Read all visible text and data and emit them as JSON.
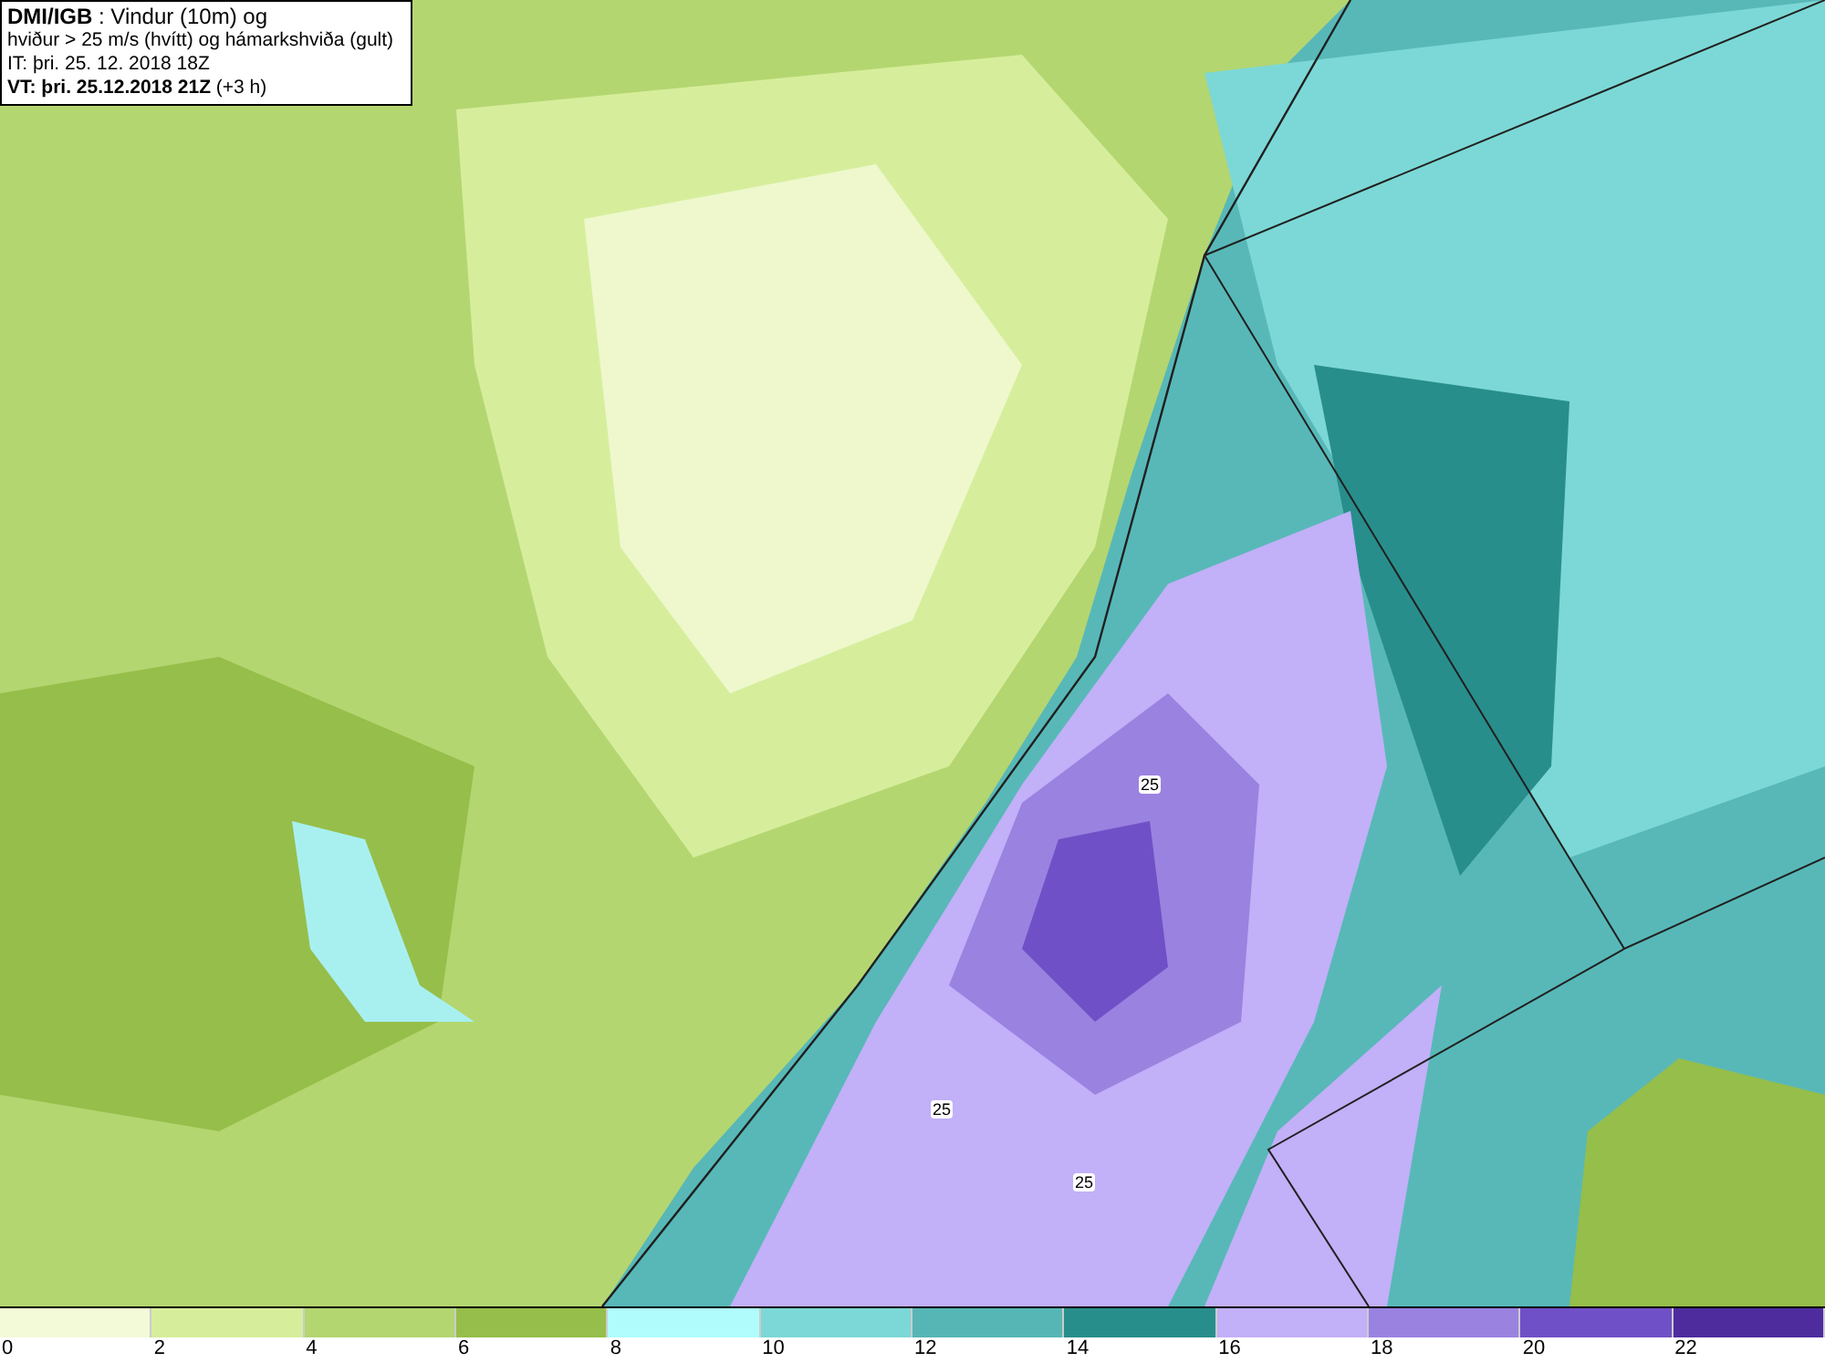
{
  "title_box": {
    "lines": [
      "**DMI/IGB** : Vindur (10m) og",
      "hviður > 25 m/s (hvítt) og hámarkshviða (gult)",
      "IT: þri. 25. 12. 2018 18Z",
      "**VT: þri. 25.12.2018 21Z** (+3 h)"
    ]
  },
  "map": {
    "contour_labels": [
      {
        "text": "25"
      },
      {
        "text": "25"
      },
      {
        "text": "25"
      }
    ]
  },
  "legend": {
    "items": [
      {
        "label": "0",
        "color": "#f2fad8"
      },
      {
        "label": "2",
        "color": "#d6ee9c"
      },
      {
        "label": "4",
        "color": "#b4d670"
      },
      {
        "label": "6",
        "color": "#96be4a"
      },
      {
        "label": "8",
        "color": "#b0fcfc"
      },
      {
        "label": "10",
        "color": "#7cd8d6"
      },
      {
        "label": "12",
        "color": "#56b6b6"
      },
      {
        "label": "14",
        "color": "#288e8c"
      },
      {
        "label": "16",
        "color": "#c2b0f8"
      },
      {
        "label": "18",
        "color": "#9a82e0"
      },
      {
        "label": "20",
        "color": "#7050c6"
      },
      {
        "label": "22",
        "color": "#4e2c9e"
      }
    ]
  }
}
